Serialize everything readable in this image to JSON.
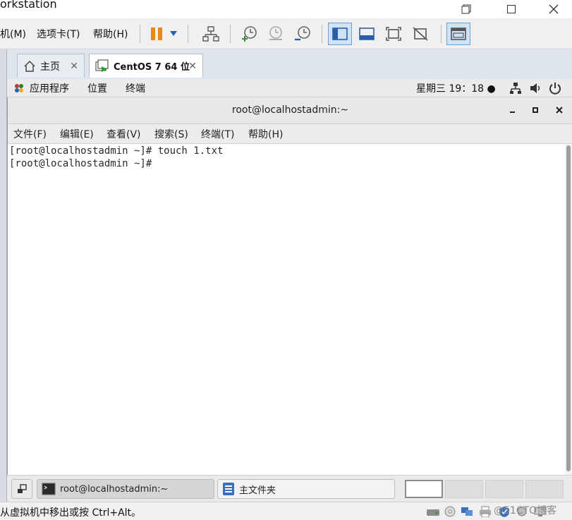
{
  "app": {
    "title": "orkstation"
  },
  "vm_menu": {
    "items": [
      "机(M)",
      "选项卡(T)",
      "帮助(H)"
    ]
  },
  "tabs": [
    {
      "label": "主页",
      "icon": "home-icon"
    },
    {
      "label": "CentOS 7 64 位",
      "icon": "vm-running-icon"
    }
  ],
  "gnome_bar": {
    "applications": "应用程序",
    "places": "位置",
    "terminal": "终端",
    "clock": "星期三 19：18 ●"
  },
  "terminal": {
    "title": "root@localhostadmin:~",
    "menu": [
      "文件(F)",
      "编辑(E)",
      "查看(V)",
      "搜索(S)",
      "终端(T)",
      "帮助(H)"
    ],
    "lines": [
      "[root@localhostadmin ~]# touch 1.txt",
      "[root@localhostadmin ~]# "
    ]
  },
  "taskbar": {
    "tasks": [
      {
        "label": "root@localhostadmin:~",
        "icon": "terminal-icon"
      },
      {
        "label": "主文件夹",
        "icon": "file-manager-icon"
      }
    ]
  },
  "statusbar": {
    "message": "从虚拟机中移出或按 Ctrl+Alt。",
    "watermark": "@51CTO博客"
  },
  "colors": {
    "toolbar_bg": "#f0f0f0",
    "active_button": "#cfe3f6",
    "pause_orange": "#e8891c",
    "terminal_bg": "#ffffff"
  }
}
